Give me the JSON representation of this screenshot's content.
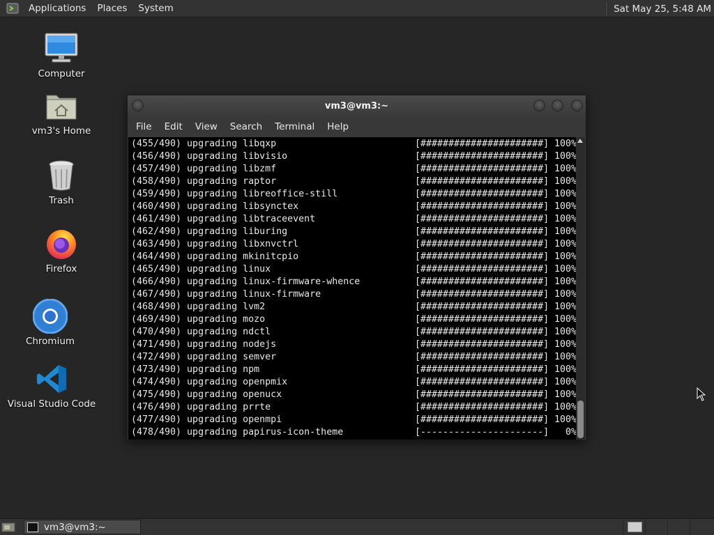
{
  "top_panel": {
    "menus": [
      "Applications",
      "Places",
      "System"
    ],
    "clock": "Sat May 25,  5:48 AM"
  },
  "desktop": {
    "icons": [
      {
        "label": "Computer",
        "icon": "computer-icon"
      },
      {
        "label": "vm3's Home",
        "icon": "home-folder-icon"
      },
      {
        "label": "Trash",
        "icon": "trash-icon"
      },
      {
        "label": "Firefox",
        "icon": "firefox-icon"
      },
      {
        "label": "Chromium",
        "icon": "chromium-icon"
      },
      {
        "label": "Visual Studio Code",
        "icon": "vscode-icon"
      }
    ]
  },
  "terminal": {
    "title": "vm3@vm3:~",
    "menu": [
      "File",
      "Edit",
      "View",
      "Search",
      "Terminal",
      "Help"
    ],
    "lines": [
      {
        "text": "(455/490) upgrading libqxp",
        "bar": "[######################]",
        "pct": "100%"
      },
      {
        "text": "(456/490) upgrading libvisio",
        "bar": "[######################]",
        "pct": "100%"
      },
      {
        "text": "(457/490) upgrading libzmf",
        "bar": "[######################]",
        "pct": "100%"
      },
      {
        "text": "(458/490) upgrading raptor",
        "bar": "[######################]",
        "pct": "100%"
      },
      {
        "text": "(459/490) upgrading libreoffice-still",
        "bar": "[######################]",
        "pct": "100%"
      },
      {
        "text": "(460/490) upgrading libsynctex",
        "bar": "[######################]",
        "pct": "100%"
      },
      {
        "text": "(461/490) upgrading libtraceevent",
        "bar": "[######################]",
        "pct": "100%"
      },
      {
        "text": "(462/490) upgrading liburing",
        "bar": "[######################]",
        "pct": "100%"
      },
      {
        "text": "(463/490) upgrading libxnvctrl",
        "bar": "[######################]",
        "pct": "100%"
      },
      {
        "text": "(464/490) upgrading mkinitcpio",
        "bar": "[######################]",
        "pct": "100%"
      },
      {
        "text": "(465/490) upgrading linux",
        "bar": "[######################]",
        "pct": "100%"
      },
      {
        "text": "(466/490) upgrading linux-firmware-whence",
        "bar": "[######################]",
        "pct": "100%"
      },
      {
        "text": "(467/490) upgrading linux-firmware",
        "bar": "[######################]",
        "pct": "100%"
      },
      {
        "text": "(468/490) upgrading lvm2",
        "bar": "[######################]",
        "pct": "100%"
      },
      {
        "text": "(469/490) upgrading mozo",
        "bar": "[######################]",
        "pct": "100%"
      },
      {
        "text": "(470/490) upgrading ndctl",
        "bar": "[######################]",
        "pct": "100%"
      },
      {
        "text": "(471/490) upgrading nodejs",
        "bar": "[######################]",
        "pct": "100%"
      },
      {
        "text": "(472/490) upgrading semver",
        "bar": "[######################]",
        "pct": "100%"
      },
      {
        "text": "(473/490) upgrading npm",
        "bar": "[######################]",
        "pct": "100%"
      },
      {
        "text": "(474/490) upgrading openpmix",
        "bar": "[######################]",
        "pct": "100%"
      },
      {
        "text": "(475/490) upgrading openucx",
        "bar": "[######################]",
        "pct": "100%"
      },
      {
        "text": "(476/490) upgrading prrte",
        "bar": "[######################]",
        "pct": "100%"
      },
      {
        "text": "(477/490) upgrading openmpi",
        "bar": "[######################]",
        "pct": "100%"
      },
      {
        "text": "(478/490) upgrading papirus-icon-theme",
        "bar": "[----------------------]",
        "pct": "0%"
      }
    ]
  },
  "taskbar": {
    "task_label": "vm3@vm3:~"
  }
}
